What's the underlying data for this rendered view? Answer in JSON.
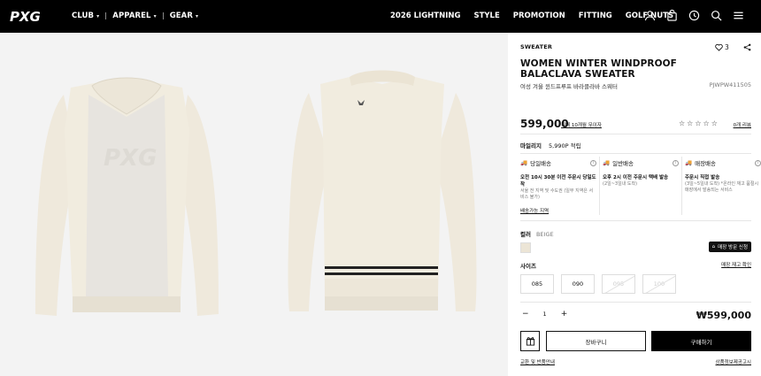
{
  "header": {
    "logo_text": "PXG",
    "nav_left": [
      {
        "label": "CLUB"
      },
      {
        "label": "APPAREL"
      },
      {
        "label": "GEAR"
      }
    ],
    "nav_right": [
      {
        "label": "2026 LIGHTNING"
      },
      {
        "label": "STYLE"
      },
      {
        "label": "PROMOTION"
      },
      {
        "label": "FITTING"
      },
      {
        "label": "GOLF NUTS"
      }
    ],
    "icons": [
      "user-icon",
      "bag-icon",
      "clock-icon",
      "search-icon",
      "menu-icon"
    ]
  },
  "gallery": {
    "images": [
      {
        "alt": "front",
        "color": "#ede7d9"
      },
      {
        "alt": "back",
        "color": "#ede7d9"
      }
    ]
  },
  "product": {
    "category": "SWEATER",
    "likes": "3",
    "name": "WOMEN WINTER WINDPROOF BALACLAVA SWEATER",
    "name_kr": "여성 겨울 윈드프루프 바라클라바 스웨터",
    "code": "PJWPW411505",
    "price": "599,000",
    "price_link": "최대 10개월 무이자",
    "review_link": "0개 리뷰",
    "rating": 0,
    "mileage_label": "마일리지",
    "mileage_value": "5,990P 적립",
    "shipping": [
      {
        "title": "당일배송",
        "bold": "오전 10시 30분 이전 주문시 당일도착",
        "sub": "서울 전 지역 및 수도권 (일부 지역은 서비스 불가)"
      },
      {
        "title": "일반배송",
        "bold": "오후 2시 이전 주문시 택배 발송",
        "sub": "(2일~3일내 도착)"
      },
      {
        "title": "매장배송",
        "bold": "주문시 직접 발송",
        "sub": "(3일~5일내 도착) *온라인 재고 품절시 매장에서 발송되는 서비스"
      }
    ],
    "shipping_link": "배송가능 지역",
    "color_label": "컬러",
    "color_value": "BEIGE",
    "store_button": "매장 방문 신청",
    "size_label": "사이즈",
    "size_guide": "매장 재고 확인",
    "sizes": [
      {
        "label": "085",
        "sold_out": false
      },
      {
        "label": "090",
        "sold_out": false
      },
      {
        "label": "095",
        "sold_out": true
      },
      {
        "label": "100",
        "sold_out": true
      }
    ],
    "quantity": "1",
    "total": "₩599,000",
    "cart_button": "장바구니",
    "buy_button": "구매하기",
    "footer_left": "교환 및 반품안내",
    "footer_right": "상품정보제공고시"
  }
}
